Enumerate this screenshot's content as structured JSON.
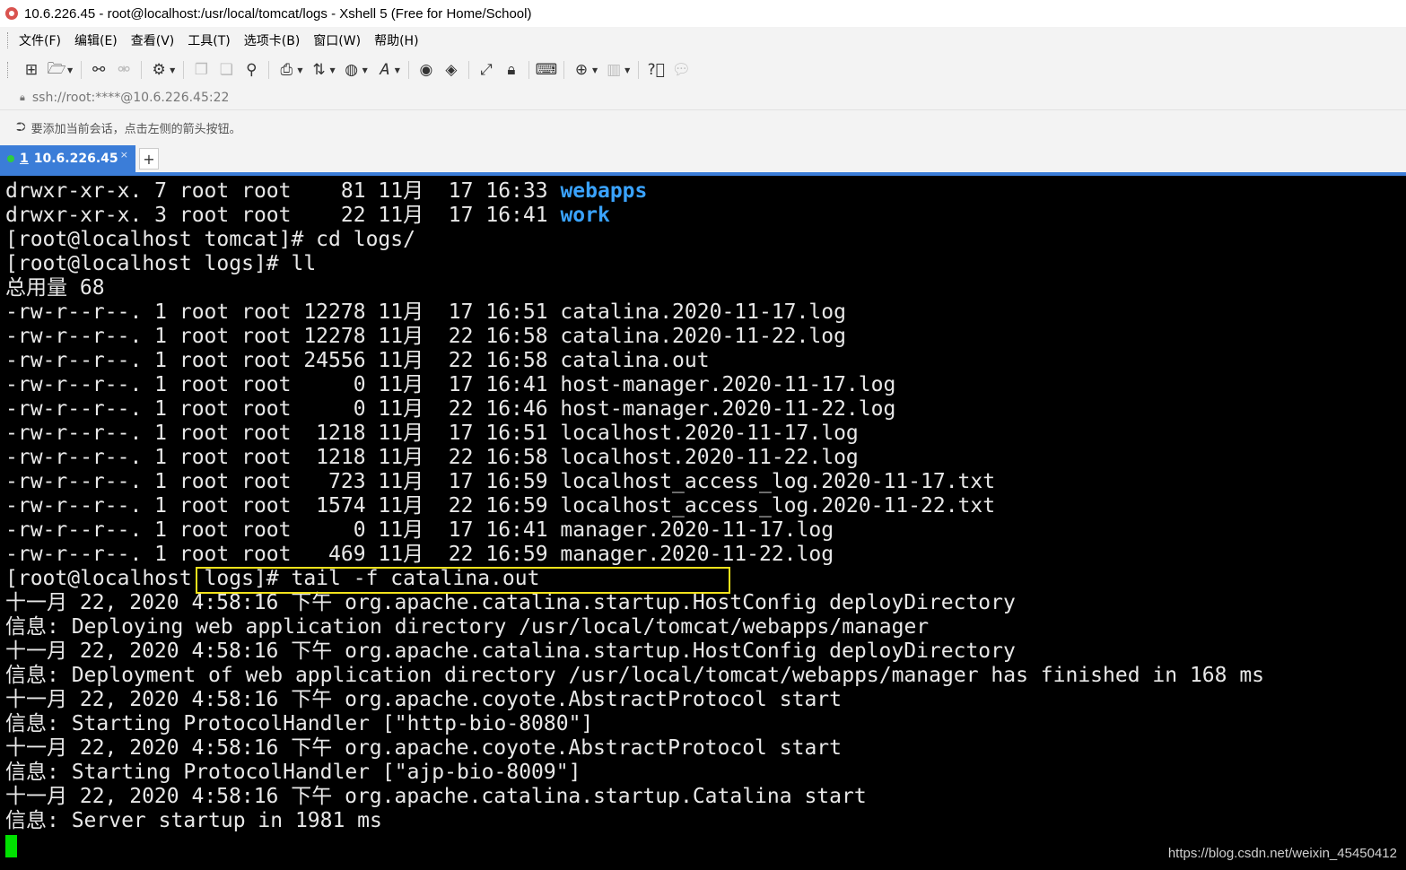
{
  "window": {
    "title": "10.6.226.45  - root@localhost:/usr/local/tomcat/logs - Xshell 5 (Free for Home/School)"
  },
  "menu": [
    {
      "label": "文件(F)"
    },
    {
      "label": "编辑(E)"
    },
    {
      "label": "查看(V)"
    },
    {
      "label": "工具(T)"
    },
    {
      "label": "选项卡(B)"
    },
    {
      "label": "窗口(W)"
    },
    {
      "label": "帮助(H)"
    }
  ],
  "address": {
    "value": "ssh://root:****@10.6.226.45:22"
  },
  "hint": {
    "text": "要添加当前会话，点击左侧的箭头按钮。"
  },
  "tab": {
    "number": "1",
    "label": "10.6.226.45",
    "close": "×",
    "new_tab": "+"
  },
  "terminal": {
    "lines": [
      {
        "prefix": "drwxr-xr-x. 7 root root    81 11月  17 16:33 ",
        "dir": "webapps"
      },
      {
        "prefix": "drwxr-xr-x. 3 root root    22 11月  17 16:41 ",
        "dir": "work"
      },
      {
        "text": "[root@localhost tomcat]# cd logs/"
      },
      {
        "text": "[root@localhost logs]# ll"
      },
      {
        "text": "总用量 68"
      },
      {
        "text": "-rw-r--r--. 1 root root 12278 11月  17 16:51 catalina.2020-11-17.log"
      },
      {
        "text": "-rw-r--r--. 1 root root 12278 11月  22 16:58 catalina.2020-11-22.log"
      },
      {
        "text": "-rw-r--r--. 1 root root 24556 11月  22 16:58 catalina.out"
      },
      {
        "text": "-rw-r--r--. 1 root root     0 11月  17 16:41 host-manager.2020-11-17.log"
      },
      {
        "text": "-rw-r--r--. 1 root root     0 11月  22 16:46 host-manager.2020-11-22.log"
      },
      {
        "text": "-rw-r--r--. 1 root root  1218 11月  17 16:51 localhost.2020-11-17.log"
      },
      {
        "text": "-rw-r--r--. 1 root root  1218 11月  22 16:58 localhost.2020-11-22.log"
      },
      {
        "text": "-rw-r--r--. 1 root root   723 11月  17 16:59 localhost_access_log.2020-11-17.txt"
      },
      {
        "text": "-rw-r--r--. 1 root root  1574 11月  22 16:59 localhost_access_log.2020-11-22.txt"
      },
      {
        "text": "-rw-r--r--. 1 root root     0 11月  17 16:41 manager.2020-11-17.log"
      },
      {
        "text": "-rw-r--r--. 1 root root   469 11月  22 16:59 manager.2020-11-22.log"
      },
      {
        "text": "[root@localhost logs]# tail -f catalina.out"
      },
      {
        "text": "十一月 22, 2020 4:58:16 下午 org.apache.catalina.startup.HostConfig deployDirectory"
      },
      {
        "text": "信息: Deploying web application directory /usr/local/tomcat/webapps/manager"
      },
      {
        "text": "十一月 22, 2020 4:58:16 下午 org.apache.catalina.startup.HostConfig deployDirectory"
      },
      {
        "text": "信息: Deployment of web application directory /usr/local/tomcat/webapps/manager has finished in 168 ms"
      },
      {
        "text": "十一月 22, 2020 4:58:16 下午 org.apache.coyote.AbstractProtocol start"
      },
      {
        "text": "信息: Starting ProtocolHandler [\"http-bio-8080\"]"
      },
      {
        "text": "十一月 22, 2020 4:58:16 下午 org.apache.coyote.AbstractProtocol start"
      },
      {
        "text": "信息: Starting ProtocolHandler [\"ajp-bio-8009\"]"
      },
      {
        "text": "十一月 22, 2020 4:58:16 下午 org.apache.catalina.startup.Catalina start"
      },
      {
        "text": "信息: Server startup in 1981 ms"
      }
    ]
  },
  "watermark": "https://blog.csdn.net/weixin_45450412",
  "colors": {
    "tab_accent": "#3b7dd8",
    "directory": "#3aa3ff",
    "highlight_box": "#f2e21c",
    "cursor": "#00e000"
  }
}
